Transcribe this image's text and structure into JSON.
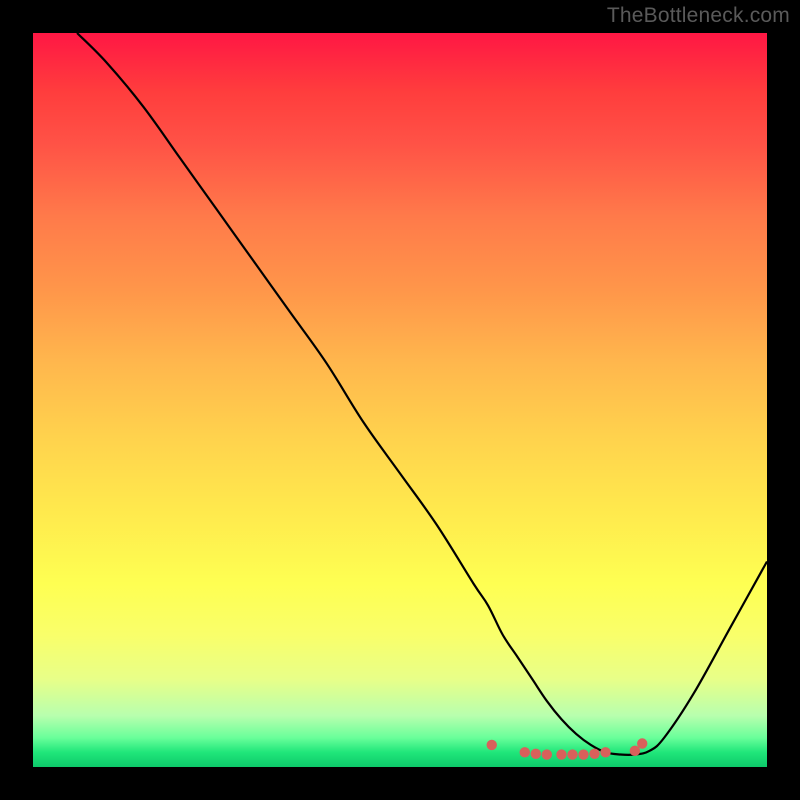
{
  "watermark": "TheBottleneck.com",
  "chart_data": {
    "type": "line",
    "title": "",
    "xlabel": "",
    "ylabel": "",
    "xlim": [
      0,
      100
    ],
    "ylim": [
      0,
      100
    ],
    "series": [
      {
        "name": "bottleneck-curve",
        "x": [
          6,
          10,
          15,
          20,
          25,
          30,
          35,
          40,
          45,
          50,
          55,
          60,
          62,
          64,
          66,
          68,
          70,
          72,
          74,
          76,
          78,
          80,
          82,
          84,
          86,
          90,
          95,
          100
        ],
        "values": [
          100,
          96,
          90,
          83,
          76,
          69,
          62,
          55,
          47,
          40,
          33,
          25,
          22,
          18,
          15,
          12,
          9,
          6.5,
          4.5,
          3,
          2,
          1.7,
          1.7,
          2.2,
          4,
          10,
          19,
          28
        ]
      }
    ],
    "markers": {
      "name": "highlight-dots",
      "color": "#d9605b",
      "points": [
        {
          "x": 62.5,
          "y": 3.0
        },
        {
          "x": 67,
          "y": 2.0
        },
        {
          "x": 68.5,
          "y": 1.8
        },
        {
          "x": 70,
          "y": 1.7
        },
        {
          "x": 72,
          "y": 1.7
        },
        {
          "x": 73.5,
          "y": 1.7
        },
        {
          "x": 75,
          "y": 1.7
        },
        {
          "x": 76.5,
          "y": 1.8
        },
        {
          "x": 78,
          "y": 2.0
        },
        {
          "x": 82,
          "y": 2.2
        },
        {
          "x": 83,
          "y": 3.2
        }
      ]
    }
  }
}
